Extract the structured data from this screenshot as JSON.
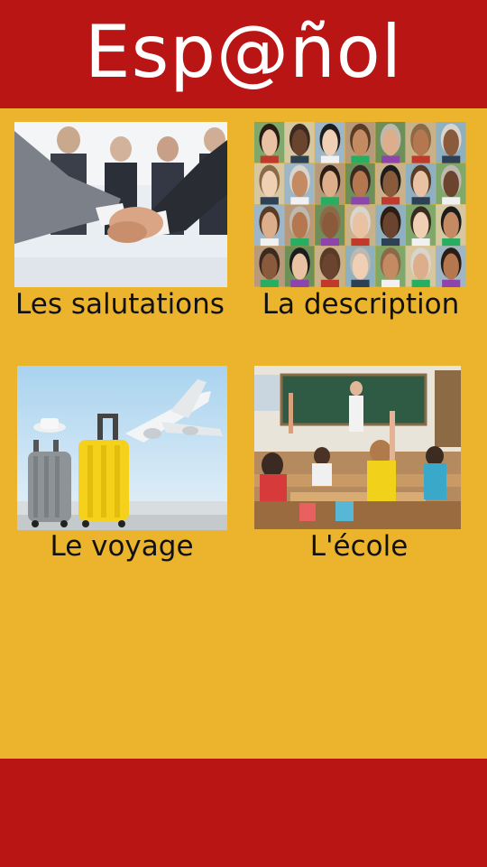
{
  "header": {
    "title": "Esp@ñol"
  },
  "tiles": [
    {
      "label": "Les salutations",
      "image": "handshake-photo"
    },
    {
      "label": "La description",
      "image": "faces-collage-photo"
    },
    {
      "label": "Le voyage",
      "image": "luggage-airplane-photo"
    },
    {
      "label": "L'école",
      "image": "classroom-photo"
    }
  ],
  "colors": {
    "header": "#b91515",
    "background": "#ebb42c",
    "footer": "#b91515"
  }
}
